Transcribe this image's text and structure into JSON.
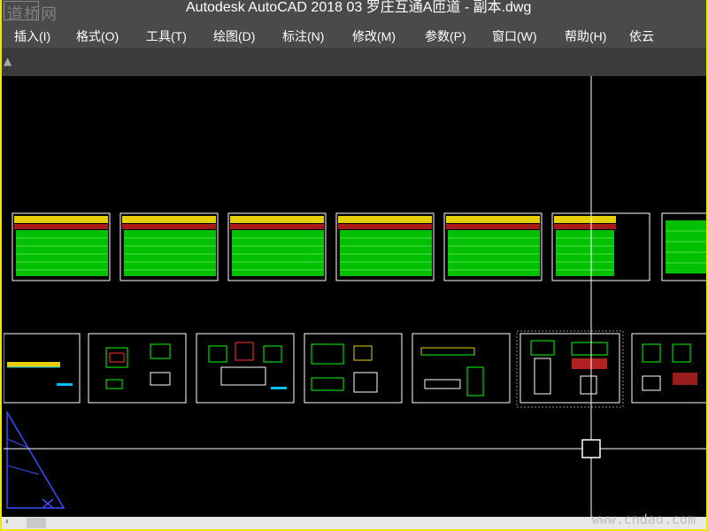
{
  "window": {
    "title": "Autodesk AutoCAD 2018      03 罗庄互通A匝道 - 副本.dwg",
    "logo_text": "道桥网"
  },
  "menu": [
    {
      "label": "插入(I)"
    },
    {
      "label": "格式(O)"
    },
    {
      "label": "工具(T)"
    },
    {
      "label": "绘图(D)"
    },
    {
      "label": "标注(N)"
    },
    {
      "label": "修改(M)"
    },
    {
      "label": "参数(P)"
    },
    {
      "label": "窗口(W)"
    },
    {
      "label": "帮助(H)"
    },
    {
      "label": "依云"
    }
  ],
  "watermark": "www.cndao.com",
  "colors": {
    "frame": "#f0e60a",
    "sheet_border": "#ffffff",
    "sheet_fill": "#00c000",
    "title_bar_yellow": "#e8d000",
    "crosshair": "#ffffff",
    "ucs": "#3a4cff"
  }
}
